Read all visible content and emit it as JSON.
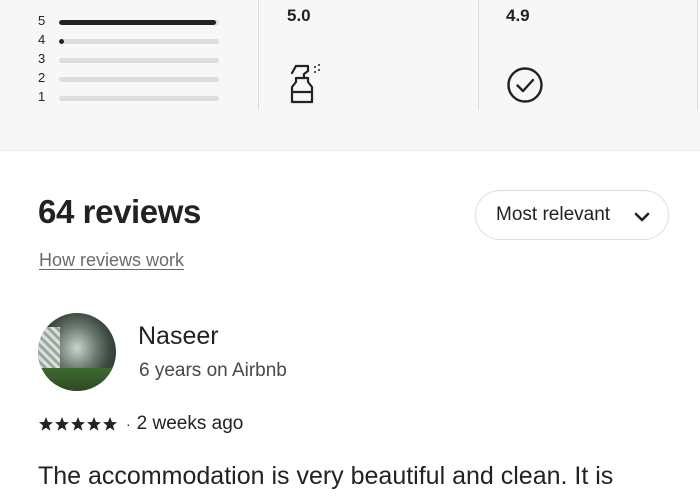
{
  "rating_distribution": [
    {
      "label": "5",
      "fraction": 0.98
    },
    {
      "label": "4",
      "fraction": 0.03
    },
    {
      "label": "3",
      "fraction": 0
    },
    {
      "label": "2",
      "fraction": 0
    },
    {
      "label": "1",
      "fraction": 0
    }
  ],
  "categories": [
    {
      "value": "5.0",
      "icon": "spray-bottle-icon"
    },
    {
      "value": "4.9",
      "icon": "check-circle-icon"
    }
  ],
  "reviews_header": {
    "count_label": "64 reviews",
    "how_link": "How reviews work",
    "sort_label": "Most relevant",
    "sort_icon": "chevron-down-icon"
  },
  "review": {
    "name": "Naseer",
    "tenure": "6 years on Airbnb",
    "stars": 5,
    "date": "2 weeks ago",
    "text": "The accommodation is very beautiful and clean. It is"
  },
  "colors": {
    "text": "#222222",
    "muted": "#6a6a6a",
    "panel_bg": "#f7f7f7",
    "border": "#dddddd"
  }
}
